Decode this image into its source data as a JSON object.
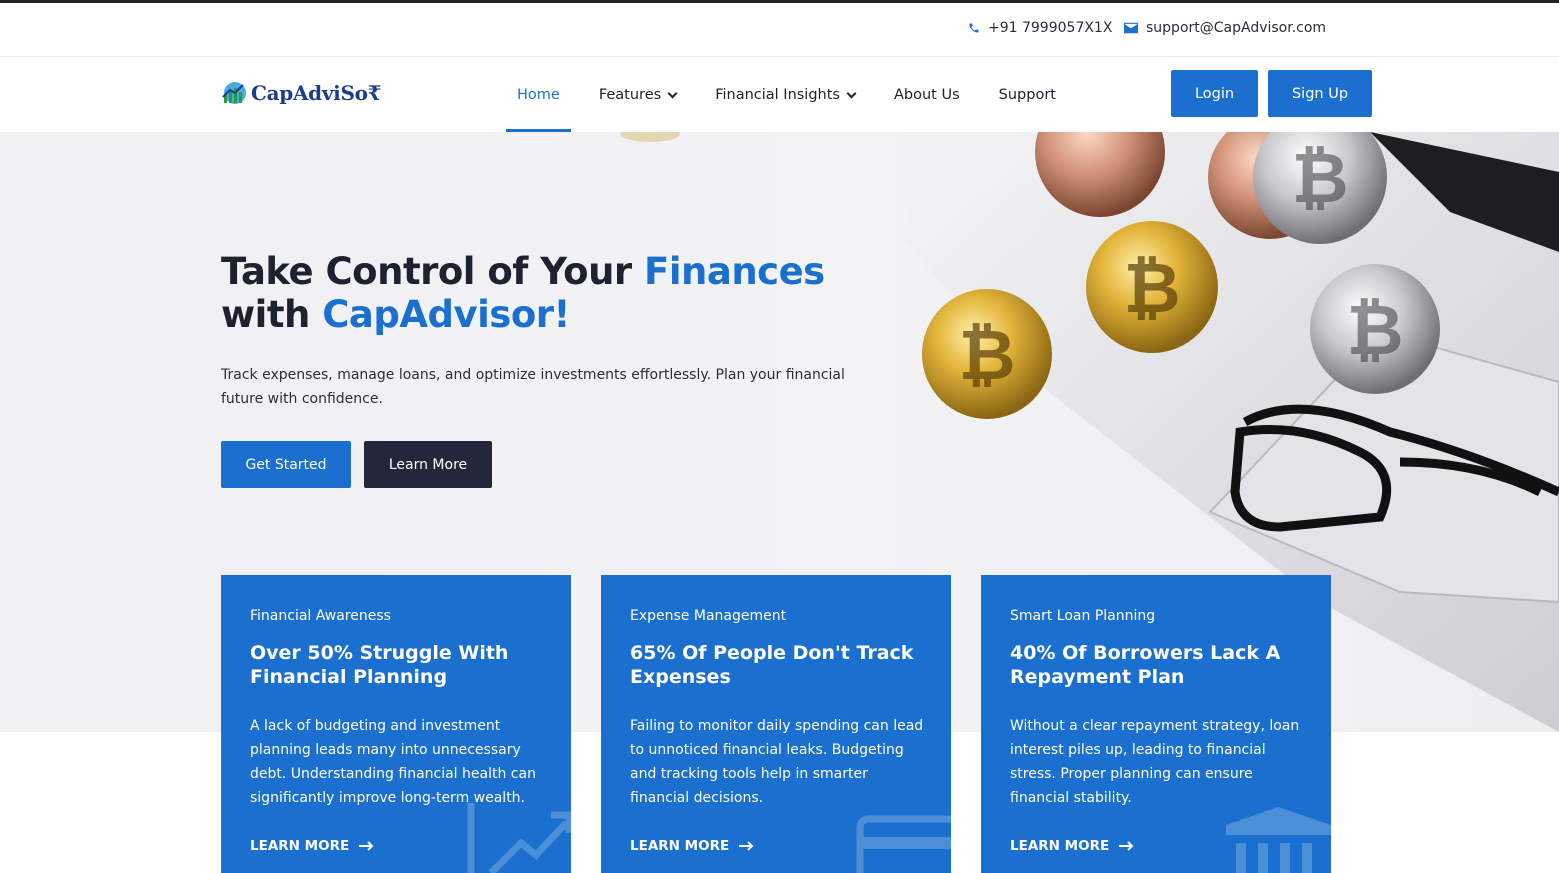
{
  "topbar": {
    "phone": "+91 7999057X1X",
    "email": "support@CapAdvisor.com"
  },
  "brand": {
    "name": "CapAdviSo₹"
  },
  "nav": {
    "items": [
      {
        "label": "Home",
        "active": true,
        "dropdown": false
      },
      {
        "label": "Features",
        "active": false,
        "dropdown": true
      },
      {
        "label": "Financial Insights",
        "active": false,
        "dropdown": true
      },
      {
        "label": "About Us",
        "active": false,
        "dropdown": false
      },
      {
        "label": "Support",
        "active": false,
        "dropdown": false
      }
    ],
    "login": "Login",
    "signup": "Sign Up"
  },
  "hero": {
    "title_part1": "Take Control of Your ",
    "title_accent1": "Finances",
    "title_part2": "with ",
    "title_accent2": "CapAdvisor!",
    "subtitle": "Track expenses, manage loans, and optimize investments effortlessly. Plan your financial future with confidence.",
    "primary_cta": "Get Started",
    "secondary_cta": "Learn More"
  },
  "cards": [
    {
      "eyebrow": "Financial Awareness",
      "title": "Over 50% Struggle With Financial Planning",
      "body": "A lack of budgeting and investment planning leads many into unnecessary debt. Understanding financial health can significantly improve long-term wealth.",
      "link": "LEARN MORE",
      "icon": "chart-growth-icon"
    },
    {
      "eyebrow": "Expense Management",
      "title": "65% Of People Don't Track Expenses",
      "body": "Failing to monitor daily spending can lead to unnoticed financial leaks. Budgeting and tracking tools help in smarter financial decisions.",
      "link": "LEARN MORE",
      "icon": "credit-card-icon"
    },
    {
      "eyebrow": "Smart Loan Planning",
      "title": "40% Of Borrowers Lack A Repayment Plan",
      "body": "Without a clear repayment strategy, loan interest piles up, leading to financial stress. Proper planning can ensure financial stability.",
      "link": "LEARN MORE",
      "icon": "bank-icon"
    }
  ],
  "colors": {
    "accent": "#1a6fcf",
    "dark": "#24273a",
    "text": "#1e2230"
  }
}
